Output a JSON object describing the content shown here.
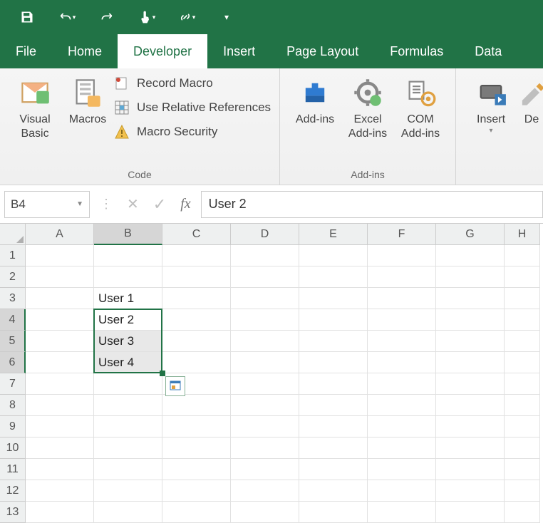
{
  "quick_access": {
    "save": "save-icon",
    "undo": "undo-icon",
    "redo": "redo-icon",
    "touch": "touch-mode-icon",
    "link": "link-icon",
    "customize": "customize-icon"
  },
  "tabs": {
    "file": "File",
    "home": "Home",
    "developer": "Developer",
    "insert": "Insert",
    "page_layout": "Page Layout",
    "formulas": "Formulas",
    "data": "Data"
  },
  "active_tab": "developer",
  "ribbon": {
    "code": {
      "label": "Code",
      "visual_basic": "Visual Basic",
      "macros": "Macros",
      "record_macro": "Record Macro",
      "use_relative": "Use Relative References",
      "macro_security": "Macro Security"
    },
    "addins": {
      "label": "Add-ins",
      "addins": "Add-ins",
      "excel_addins": "Excel Add-ins",
      "com_addins": "COM Add-ins"
    },
    "controls": {
      "insert": "Insert",
      "design_mode_partial": "De"
    }
  },
  "name_box": "B4",
  "formula_value": "User 2",
  "columns": [
    "A",
    "B",
    "C",
    "D",
    "E",
    "F",
    "G",
    "H"
  ],
  "rows": [
    "1",
    "2",
    "3",
    "4",
    "5",
    "6",
    "7",
    "8",
    "9",
    "10",
    "11",
    "12",
    "13"
  ],
  "selected_column_index": 1,
  "selected_row_indices": [
    3,
    4,
    5
  ],
  "cells": {
    "B3": "User 1",
    "B4": "User 2",
    "B5": "User 3",
    "B6": "User 4"
  },
  "selection": {
    "col": 1,
    "row_start": 3,
    "row_end": 5
  },
  "fill_highlight_rows": [
    4,
    5
  ]
}
